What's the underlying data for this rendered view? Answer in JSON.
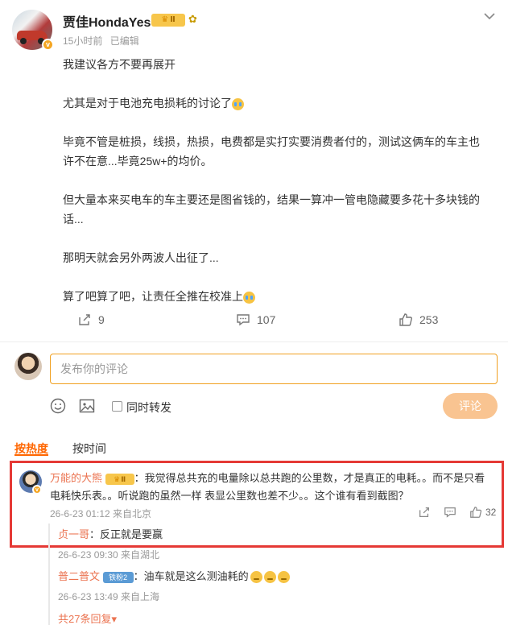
{
  "post": {
    "author": "贾佳HondaYes",
    "author_badge": "Ⅱ",
    "time": "15小时前",
    "edited": "已编辑",
    "verified": "v",
    "paragraphs": [
      "我建议各方不要再展开",
      "尤其是对于电池充电损耗的讨论了",
      "毕竟不管是桩损，线损，热损，电费都是实打实要消费者付的，测试这俩车的车主也许不在意...毕竟25w+的均价。",
      "但大量本来买电车的车主要还是图省钱的，结果一算冲一管电隐藏要多花十多块钱的话...",
      "那明天就会另外两波人出征了...",
      "算了吧算了吧，让责任全推在校准上"
    ],
    "reposts": "9",
    "comments": "107",
    "likes": "253"
  },
  "composer": {
    "placeholder": "发布你的评论",
    "repost_label": "同时转发",
    "submit_label": "评论"
  },
  "sort_tabs": {
    "hot": "按热度",
    "time": "按时间"
  },
  "comment": {
    "author": "万能的大熊",
    "badge": "Ⅱ",
    "text_line1": "：我觉得总共充的电量除以总共跑的公里数，才是真正的电耗。。而不是只看",
    "text_line2": "电耗快乐表。。听说跑的虽然一样 表显公里数也差不少。。这个谁有看到截图？",
    "time": "26-6-23 01:12 来自北京",
    "likes": "32"
  },
  "replies": [
    {
      "author": "贞一哥",
      "text": "：反正就是要赢",
      "time": "26-6-23 09:30 来自湖北"
    },
    {
      "author": "普二普文",
      "badge": "铁粉2",
      "text": "：油车就是这么测油耗的",
      "time": "26-6-23 13:49 来自上海"
    }
  ],
  "more_replies": "共27条回复",
  "colors": {
    "accent": "#f60",
    "name": "#eb7350",
    "highlight": "#e53935",
    "submit": "#f9c491"
  }
}
